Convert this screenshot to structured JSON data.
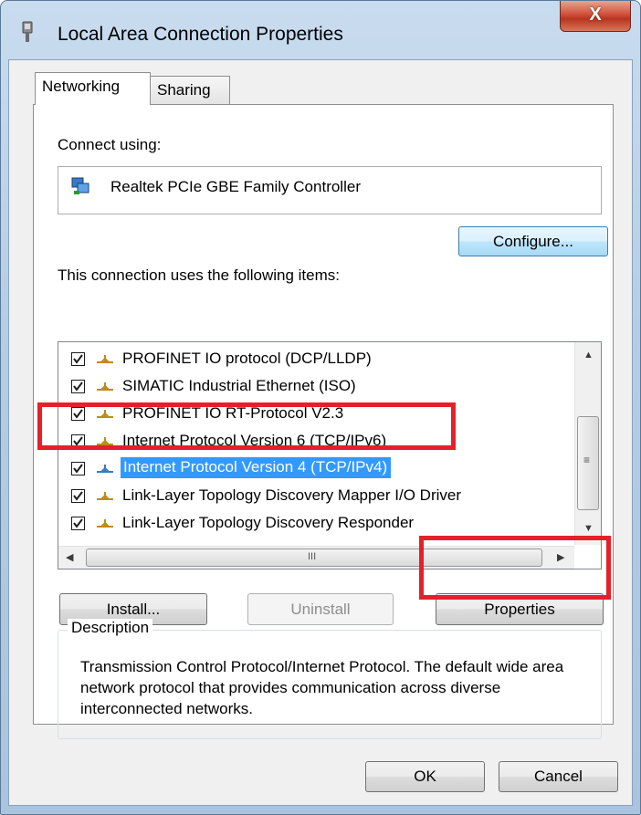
{
  "window": {
    "title": "Local Area Connection Properties",
    "close_label": "X"
  },
  "tabs": [
    {
      "label": "Networking",
      "active": true
    },
    {
      "label": "Sharing",
      "active": false
    }
  ],
  "connect_using": {
    "label": "Connect using:",
    "adapter": "Realtek PCIe GBE Family Controller"
  },
  "configure_label": "Configure...",
  "items_label": "This connection uses the following items:",
  "items": [
    {
      "label": "PROFINET IO protocol (DCP/LLDP)",
      "checked": true,
      "selected": false
    },
    {
      "label": "SIMATIC Industrial Ethernet (ISO)",
      "checked": true,
      "selected": false
    },
    {
      "label": "PROFINET IO RT-Protocol V2.3",
      "checked": true,
      "selected": false
    },
    {
      "label": "Internet Protocol Version 6 (TCP/IPv6)",
      "checked": true,
      "selected": false
    },
    {
      "label": "Internet Protocol Version 4 (TCP/IPv4)",
      "checked": true,
      "selected": true
    },
    {
      "label": "Link-Layer Topology Discovery Mapper I/O Driver",
      "checked": true,
      "selected": false
    },
    {
      "label": "Link-Layer Topology Discovery Responder",
      "checked": true,
      "selected": false
    }
  ],
  "scrollbar": {
    "up_arrow": "▲",
    "down_arrow": "▼",
    "left_arrow": "◀",
    "right_arrow": "▶",
    "v_grip": "≡",
    "h_grip": "III"
  },
  "buttons": {
    "install": "Install...",
    "uninstall": "Uninstall",
    "properties": "Properties",
    "ok": "OK",
    "cancel": "Cancel"
  },
  "description": {
    "legend": "Description",
    "text": "Transmission Control Protocol/Internet Protocol. The default wide area network protocol that provides communication across diverse interconnected networks."
  },
  "colors": {
    "highlight": "#e4202a",
    "selection": "#3399ff"
  }
}
